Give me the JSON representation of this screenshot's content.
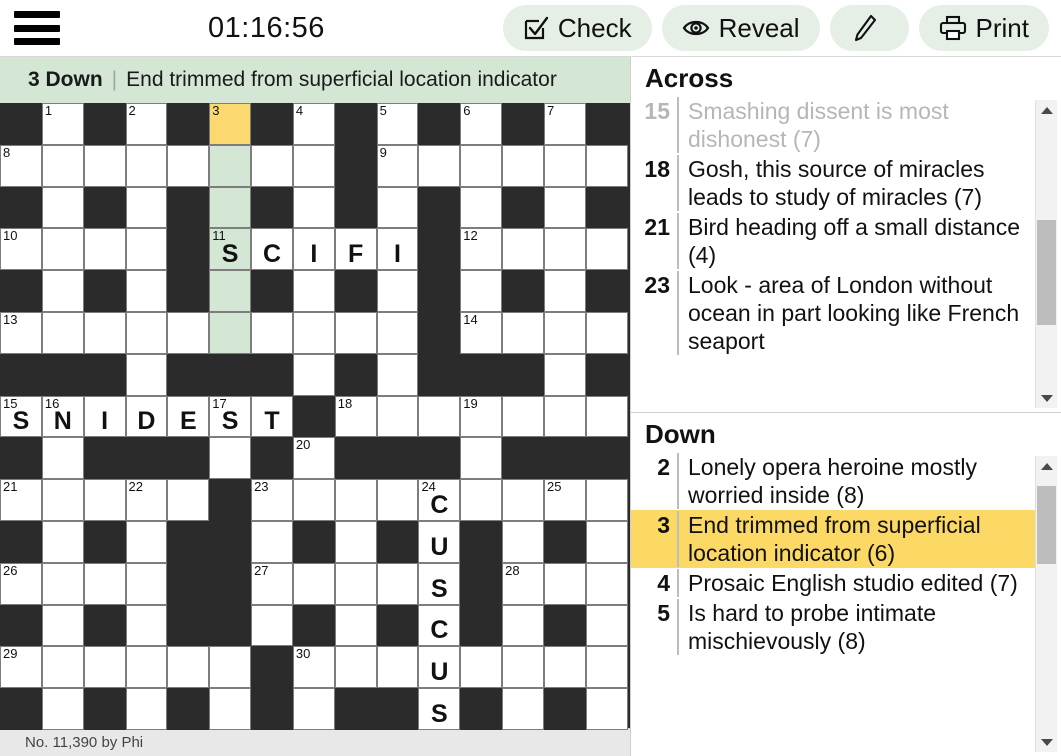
{
  "toolbar": {
    "menu_icon": "hamburger-menu-icon",
    "timer": "01:16:56",
    "check_label": "Check",
    "reveal_label": "Reveal",
    "pencil_label": "",
    "print_label": "Print",
    "button_bg": "#e5efe6"
  },
  "current_clue": {
    "number": "3 Down",
    "separator": "|",
    "text": "End trimmed from superficial location indicator",
    "bar_bg": "#d4e6d4"
  },
  "footer": {
    "credit": "No. 11,390 by Phi"
  },
  "grid": {
    "rows": 15,
    "cols": 15,
    "cursor_color": "#fbd870",
    "word_highlight_color": "#d4e6d4",
    "block_color": "#2b2b2b",
    "cells": [
      [
        {
          "t": "b"
        },
        {
          "t": "w",
          "n": "1"
        },
        {
          "t": "b"
        },
        {
          "t": "w",
          "n": "2"
        },
        {
          "t": "b"
        },
        {
          "t": "w",
          "n": "3",
          "hl": "cursor"
        },
        {
          "t": "b"
        },
        {
          "t": "w",
          "n": "4"
        },
        {
          "t": "b"
        },
        {
          "t": "w",
          "n": "5"
        },
        {
          "t": "b"
        },
        {
          "t": "w",
          "n": "6"
        },
        {
          "t": "b"
        },
        {
          "t": "w",
          "n": "7"
        },
        {
          "t": "b"
        }
      ],
      [
        {
          "t": "w",
          "n": "8"
        },
        {
          "t": "w"
        },
        {
          "t": "w"
        },
        {
          "t": "w"
        },
        {
          "t": "w"
        },
        {
          "t": "w",
          "hl": "word"
        },
        {
          "t": "w"
        },
        {
          "t": "w"
        },
        {
          "t": "b"
        },
        {
          "t": "w",
          "n": "9"
        },
        {
          "t": "w"
        },
        {
          "t": "w"
        },
        {
          "t": "w"
        },
        {
          "t": "w"
        },
        {
          "t": "w"
        }
      ],
      [
        {
          "t": "b"
        },
        {
          "t": "w"
        },
        {
          "t": "b"
        },
        {
          "t": "w"
        },
        {
          "t": "b"
        },
        {
          "t": "w",
          "hl": "word"
        },
        {
          "t": "b"
        },
        {
          "t": "w"
        },
        {
          "t": "b"
        },
        {
          "t": "w"
        },
        {
          "t": "b"
        },
        {
          "t": "w"
        },
        {
          "t": "b"
        },
        {
          "t": "w"
        },
        {
          "t": "b"
        }
      ],
      [
        {
          "t": "w",
          "n": "10"
        },
        {
          "t": "w"
        },
        {
          "t": "w"
        },
        {
          "t": "w"
        },
        {
          "t": "b"
        },
        {
          "t": "w",
          "n": "11",
          "hl": "word",
          "l": "S"
        },
        {
          "t": "w",
          "l": "C"
        },
        {
          "t": "w",
          "l": "I"
        },
        {
          "t": "w",
          "l": "F"
        },
        {
          "t": "w",
          "l": "I"
        },
        {
          "t": "b"
        },
        {
          "t": "w",
          "n": "12"
        },
        {
          "t": "w"
        },
        {
          "t": "w"
        },
        {
          "t": "w"
        }
      ],
      [
        {
          "t": "b"
        },
        {
          "t": "w"
        },
        {
          "t": "b"
        },
        {
          "t": "w"
        },
        {
          "t": "b"
        },
        {
          "t": "w",
          "hl": "word"
        },
        {
          "t": "b"
        },
        {
          "t": "w"
        },
        {
          "t": "b"
        },
        {
          "t": "w"
        },
        {
          "t": "b"
        },
        {
          "t": "w"
        },
        {
          "t": "b"
        },
        {
          "t": "w"
        },
        {
          "t": "b"
        }
      ],
      [
        {
          "t": "w",
          "n": "13"
        },
        {
          "t": "w"
        },
        {
          "t": "w"
        },
        {
          "t": "w"
        },
        {
          "t": "w"
        },
        {
          "t": "w",
          "hl": "word"
        },
        {
          "t": "w"
        },
        {
          "t": "w"
        },
        {
          "t": "w"
        },
        {
          "t": "w"
        },
        {
          "t": "b"
        },
        {
          "t": "w",
          "n": "14"
        },
        {
          "t": "w"
        },
        {
          "t": "w"
        },
        {
          "t": "w"
        }
      ],
      [
        {
          "t": "b"
        },
        {
          "t": "b"
        },
        {
          "t": "b"
        },
        {
          "t": "w"
        },
        {
          "t": "b"
        },
        {
          "t": "b"
        },
        {
          "t": "b"
        },
        {
          "t": "w"
        },
        {
          "t": "b"
        },
        {
          "t": "w"
        },
        {
          "t": "b"
        },
        {
          "t": "b"
        },
        {
          "t": "b"
        },
        {
          "t": "w"
        },
        {
          "t": "b"
        }
      ],
      [
        {
          "t": "w",
          "n": "15",
          "l": "S"
        },
        {
          "t": "w",
          "n": "16",
          "l": "N"
        },
        {
          "t": "w",
          "l": "I"
        },
        {
          "t": "w",
          "l": "D"
        },
        {
          "t": "w",
          "l": "E"
        },
        {
          "t": "w",
          "n": "17",
          "l": "S"
        },
        {
          "t": "w",
          "l": "T"
        },
        {
          "t": "b"
        },
        {
          "t": "w",
          "n": "18"
        },
        {
          "t": "w"
        },
        {
          "t": "w"
        },
        {
          "t": "w",
          "n": "19"
        },
        {
          "t": "w"
        },
        {
          "t": "w"
        },
        {
          "t": "w"
        }
      ],
      [
        {
          "t": "b"
        },
        {
          "t": "w"
        },
        {
          "t": "b"
        },
        {
          "t": "b"
        },
        {
          "t": "b"
        },
        {
          "t": "w"
        },
        {
          "t": "b"
        },
        {
          "t": "w",
          "n": "20"
        },
        {
          "t": "b"
        },
        {
          "t": "b"
        },
        {
          "t": "b"
        },
        {
          "t": "w"
        },
        {
          "t": "b"
        },
        {
          "t": "b"
        },
        {
          "t": "b"
        }
      ],
      [
        {
          "t": "w",
          "n": "21"
        },
        {
          "t": "w"
        },
        {
          "t": "w"
        },
        {
          "t": "w",
          "n": "22"
        },
        {
          "t": "w"
        },
        {
          "t": "b"
        },
        {
          "t": "w",
          "n": "23"
        },
        {
          "t": "w"
        },
        {
          "t": "w"
        },
        {
          "t": "w"
        },
        {
          "t": "w",
          "n": "24",
          "l": "C"
        },
        {
          "t": "w"
        },
        {
          "t": "w"
        },
        {
          "t": "w",
          "n": "25"
        },
        {
          "t": "w"
        }
      ],
      [
        {
          "t": "b"
        },
        {
          "t": "w"
        },
        {
          "t": "b"
        },
        {
          "t": "w"
        },
        {
          "t": "b"
        },
        {
          "t": "b"
        },
        {
          "t": "w"
        },
        {
          "t": "b"
        },
        {
          "t": "w"
        },
        {
          "t": "b"
        },
        {
          "t": "w",
          "l": "U"
        },
        {
          "t": "b"
        },
        {
          "t": "w"
        },
        {
          "t": "b"
        },
        {
          "t": "w"
        }
      ],
      [
        {
          "t": "w",
          "n": "26"
        },
        {
          "t": "w"
        },
        {
          "t": "w"
        },
        {
          "t": "w"
        },
        {
          "t": "b"
        },
        {
          "t": "b"
        },
        {
          "t": "w",
          "n": "27"
        },
        {
          "t": "w"
        },
        {
          "t": "w"
        },
        {
          "t": "w"
        },
        {
          "t": "w",
          "l": "S"
        },
        {
          "t": "b"
        },
        {
          "t": "w",
          "n": "28"
        },
        {
          "t": "w"
        },
        {
          "t": "w"
        }
      ],
      [
        {
          "t": "b"
        },
        {
          "t": "w"
        },
        {
          "t": "b"
        },
        {
          "t": "w"
        },
        {
          "t": "b"
        },
        {
          "t": "b"
        },
        {
          "t": "w"
        },
        {
          "t": "b"
        },
        {
          "t": "w"
        },
        {
          "t": "b"
        },
        {
          "t": "w",
          "l": "C"
        },
        {
          "t": "b"
        },
        {
          "t": "w"
        },
        {
          "t": "b"
        },
        {
          "t": "w"
        }
      ],
      [
        {
          "t": "w",
          "n": "29"
        },
        {
          "t": "w"
        },
        {
          "t": "w"
        },
        {
          "t": "w"
        },
        {
          "t": "w"
        },
        {
          "t": "w"
        },
        {
          "t": "b"
        },
        {
          "t": "w",
          "n": "30"
        },
        {
          "t": "w"
        },
        {
          "t": "w"
        },
        {
          "t": "w",
          "l": "U"
        },
        {
          "t": "w"
        },
        {
          "t": "w"
        },
        {
          "t": "w"
        },
        {
          "t": "w"
        }
      ],
      [
        {
          "t": "b"
        },
        {
          "t": "w"
        },
        {
          "t": "b"
        },
        {
          "t": "w"
        },
        {
          "t": "b"
        },
        {
          "t": "w"
        },
        {
          "t": "b"
        },
        {
          "t": "w"
        },
        {
          "t": "b"
        },
        {
          "t": "b"
        },
        {
          "t": "w",
          "l": "S"
        },
        {
          "t": "b"
        },
        {
          "t": "w"
        },
        {
          "t": "b"
        },
        {
          "t": "w"
        }
      ]
    ]
  },
  "clues": {
    "across": {
      "title": "Across",
      "items": [
        {
          "num": "15",
          "text": "Smashing dissent is most dishonest (7)",
          "state": "dimmed"
        },
        {
          "num": "18",
          "text": "Gosh, this source of miracles leads to study of miracles (7)",
          "state": "normal"
        },
        {
          "num": "21",
          "text": "Bird heading off a small distance (4)",
          "state": "normal"
        },
        {
          "num": "23",
          "text": "Look - area of London without ocean in part looking like French seaport",
          "state": "normal"
        }
      ]
    },
    "down": {
      "title": "Down",
      "items": [
        {
          "num": "2",
          "text": "Lonely opera heroine mostly worried inside (8)",
          "state": "normal"
        },
        {
          "num": "3",
          "text": "End trimmed from superficial location indicator (6)",
          "state": "selected"
        },
        {
          "num": "4",
          "text": "Prosaic English studio edited (7)",
          "state": "normal"
        },
        {
          "num": "5",
          "text": "Is hard to probe intimate mischievously (8)",
          "state": "normal"
        }
      ]
    },
    "selected_bg": "#fcd965"
  }
}
